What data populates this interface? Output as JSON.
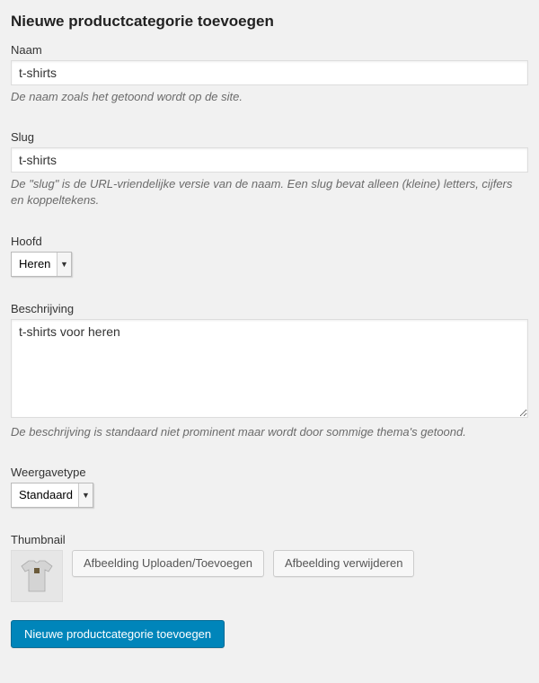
{
  "page_title": "Nieuwe productcategorie toevoegen",
  "fields": {
    "name": {
      "label": "Naam",
      "value": "t-shirts",
      "help": "De naam zoals het getoond wordt op de site."
    },
    "slug": {
      "label": "Slug",
      "value": "t-shirts",
      "help": "De \"slug\" is de URL-vriendelijke versie van de naam. Een slug bevat alleen (kleine) letters, cijfers en koppeltekens."
    },
    "parent": {
      "label": "Hoofd",
      "selected": "Heren"
    },
    "description": {
      "label": "Beschrijving",
      "value": "t-shirts voor heren",
      "help": "De beschrijving is standaard niet prominent maar wordt door sommige thema's getoond."
    },
    "display_type": {
      "label": "Weergavetype",
      "selected": "Standaard"
    },
    "thumbnail": {
      "label": "Thumbnail",
      "upload_button": "Afbeelding Uploaden/Toevoegen",
      "remove_button": "Afbeelding verwijderen"
    }
  },
  "submit_label": "Nieuwe productcategorie toevoegen"
}
